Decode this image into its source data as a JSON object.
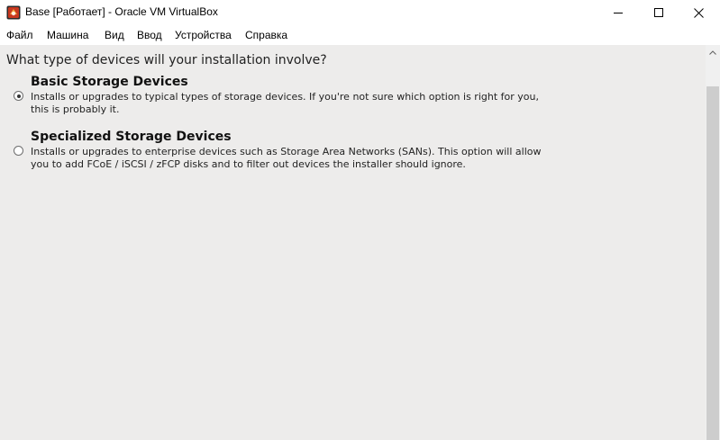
{
  "window": {
    "title": "Base [Работает] - Oracle VM VirtualBox",
    "icon": "virtualbox-icon",
    "controls": [
      "minimize-icon",
      "maximize-icon",
      "close-icon"
    ]
  },
  "menu": {
    "items": [
      "Файл",
      "Машина",
      "Вид",
      "Ввод",
      "Устройства",
      "Справка"
    ]
  },
  "installer": {
    "question": "What type of devices will your installation involve?",
    "options": [
      {
        "title": "Basic Storage Devices",
        "desc_line1": "Installs or upgrades to typical types of storage devices.  If you're not sure which option is right for you,",
        "desc_line2": "this is probably it.",
        "selected": true
      },
      {
        "title": "Specialized Storage Devices",
        "desc_line1": "Installs or upgrades to enterprise devices such as Storage Area Networks (SANs). This option will allow",
        "desc_line2": "you to add FCoE / iSCSI / zFCP disks and to filter out devices the installer should ignore.",
        "selected": false
      }
    ]
  }
}
